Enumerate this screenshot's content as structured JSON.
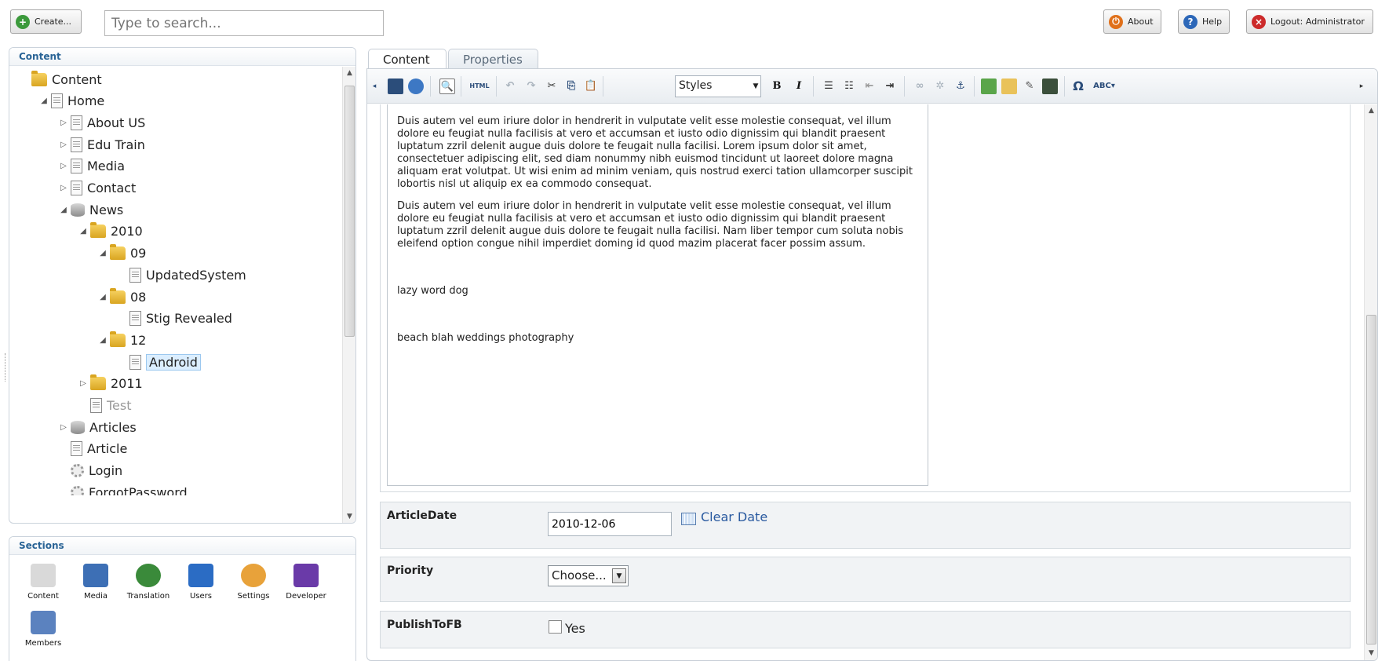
{
  "toolbar_top": {
    "create_label": "Create...",
    "search_placeholder": "Type to search...",
    "about_label": "About",
    "help_label": "Help",
    "logout_label": "Logout: Administrator"
  },
  "content_panel": {
    "title": "Content",
    "tree": [
      {
        "label": "Content",
        "icon": "folder-icon",
        "depth": 0,
        "arrow": ""
      },
      {
        "label": "Home",
        "icon": "document-icon",
        "depth": 1,
        "arrow": "expanded"
      },
      {
        "label": "About US",
        "icon": "document-icon",
        "depth": 2,
        "arrow": "collapsed"
      },
      {
        "label": "Edu Train",
        "icon": "document-icon",
        "depth": 2,
        "arrow": "collapsed"
      },
      {
        "label": "Media",
        "icon": "document-icon",
        "depth": 2,
        "arrow": "collapsed"
      },
      {
        "label": "Contact",
        "icon": "document-icon",
        "depth": 2,
        "arrow": "collapsed"
      },
      {
        "label": "News",
        "icon": "database-icon",
        "depth": 2,
        "arrow": "expanded"
      },
      {
        "label": "2010",
        "icon": "folder-icon",
        "depth": 3,
        "arrow": "expanded"
      },
      {
        "label": "09",
        "icon": "folder-icon",
        "depth": 4,
        "arrow": "expanded"
      },
      {
        "label": "UpdatedSystem",
        "icon": "document-icon",
        "depth": 5,
        "arrow": ""
      },
      {
        "label": "08",
        "icon": "folder-icon",
        "depth": 4,
        "arrow": "expanded"
      },
      {
        "label": "Stig Revealed",
        "icon": "document-icon",
        "depth": 5,
        "arrow": ""
      },
      {
        "label": "12",
        "icon": "folder-icon",
        "depth": 4,
        "arrow": "expanded"
      },
      {
        "label": "Android",
        "icon": "document-icon",
        "depth": 5,
        "arrow": "",
        "selected": true
      },
      {
        "label": "2011",
        "icon": "folder-icon",
        "depth": 3,
        "arrow": "collapsed"
      },
      {
        "label": "Test",
        "icon": "document-icon",
        "depth": 3,
        "arrow": "",
        "dimmed": true
      },
      {
        "label": "Articles",
        "icon": "database-icon",
        "depth": 2,
        "arrow": "collapsed"
      },
      {
        "label": "Article",
        "icon": "document-icon",
        "depth": 2,
        "arrow": ""
      },
      {
        "label": "Login",
        "icon": "gear-icon",
        "depth": 2,
        "arrow": ""
      },
      {
        "label": "ForgotPassword",
        "icon": "gear-icon",
        "depth": 2,
        "arrow": ""
      }
    ]
  },
  "sections_panel": {
    "title": "Sections",
    "items": [
      {
        "label": "Content",
        "icon": "pencil-icon",
        "color": "#d9d9d9"
      },
      {
        "label": "Media",
        "icon": "monitor-icon",
        "color": "#3d6fb5"
      },
      {
        "label": "Translation",
        "icon": "globe-icon",
        "color": "#3a8a3a"
      },
      {
        "label": "Users",
        "icon": "user-icon",
        "color": "#2b6cc4"
      },
      {
        "label": "Settings",
        "icon": "color-wheel-icon",
        "color": "#e8a23a"
      },
      {
        "label": "Developer",
        "icon": "magic-wand-icon",
        "color": "#6a3aa8"
      },
      {
        "label": "Members",
        "icon": "member-card-icon",
        "color": "#5b82bf"
      }
    ]
  },
  "editor": {
    "tabs": [
      "Content",
      "Properties"
    ],
    "styles_label": "Styles",
    "html_label": "HTML",
    "body": {
      "p1": "Duis autem vel eum iriure dolor in hendrerit in vulputate velit esse molestie consequat, vel illum dolore eu feugiat nulla facilisis at vero et accumsan et iusto odio dignissim qui blandit praesent luptatum zzril delenit augue duis dolore te feugait nulla facilisi. Lorem ipsum dolor sit amet, consectetuer adipiscing elit, sed diam nonummy nibh euismod tincidunt ut laoreet dolore magna aliquam erat volutpat. Ut wisi enim ad minim veniam, quis nostrud exerci tation ullamcorper suscipit lobortis nisl ut aliquip ex ea commodo consequat.",
      "p2": "Duis autem vel eum iriure dolor in hendrerit in vulputate velit esse molestie consequat, vel illum dolore eu feugiat nulla facilisis at vero et accumsan et iusto odio dignissim qui blandit praesent luptatum zzril delenit augue duis dolore te feugait nulla facilisi. Nam liber tempor cum soluta nobis eleifend option congue nihil imperdiet doming id quod mazim placerat facer possim assum.",
      "p3": "lazy word dog",
      "p4": "beach blah weddings photography"
    }
  },
  "properties": {
    "article_date": {
      "label": "ArticleDate",
      "value": "2010-12-06",
      "clear_label": "Clear Date"
    },
    "priority": {
      "label": "Priority",
      "value": "Choose..."
    },
    "publish_to_fb": {
      "label": "PublishToFB",
      "option": "Yes",
      "checked": false
    }
  }
}
